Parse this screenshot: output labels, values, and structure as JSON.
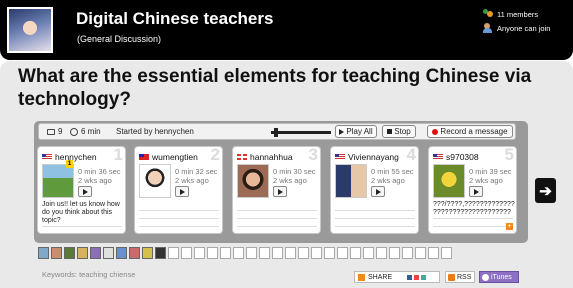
{
  "group": {
    "title": "Digital Chinese teachers",
    "subtitle": "(General Discussion)",
    "members": "11 members",
    "join_policy": "Anyone can join"
  },
  "topic": {
    "title": "What are the essential elements for teaching Chinese via technology?"
  },
  "toolbar": {
    "comment_count": "9",
    "duration": "6 min",
    "started_by": "Started by hennychen",
    "progress_fraction": 0.05,
    "play_all": "Play All",
    "stop": "Stop",
    "record": "Record a message"
  },
  "cards": [
    {
      "num": "1",
      "name": "hennychen",
      "flag": "us",
      "duration": "0 min 36 sec",
      "age": "2 wks ago",
      "text": "Join us!! let us know how do you think about this topic?",
      "badge": "1"
    },
    {
      "num": "2",
      "name": "wumengtien",
      "flag": "tw",
      "duration": "0 min 32 sec",
      "age": "2 wks ago",
      "text": ""
    },
    {
      "num": "3",
      "name": "hannahhua",
      "flag": "gb",
      "duration": "0 min 30 sec",
      "age": "2 wks ago",
      "text": ""
    },
    {
      "num": "4",
      "name": "Viviennayang",
      "flag": "us",
      "duration": "0 min 55 sec",
      "age": "2 wks ago",
      "text": ""
    },
    {
      "num": "5",
      "name": "s970308",
      "flag": "us",
      "duration": "0 min 39 sec",
      "age": "2 wks ago",
      "text": "???/????,????????????? ????????????????????"
    }
  ],
  "strip": {
    "filled": 10,
    "total": 32
  },
  "footer": {
    "keywords": "Keywords: teaching chiense",
    "share": "SHARE",
    "rss": "RSS",
    "itunes": "iTunes"
  },
  "colors": {
    "header_bg": "#000000",
    "panel_bg": "#e9e9e9",
    "player_bg": "#9a9a9a",
    "record_red": "#dd1111",
    "itunes_purple": "#8d6fc4"
  }
}
